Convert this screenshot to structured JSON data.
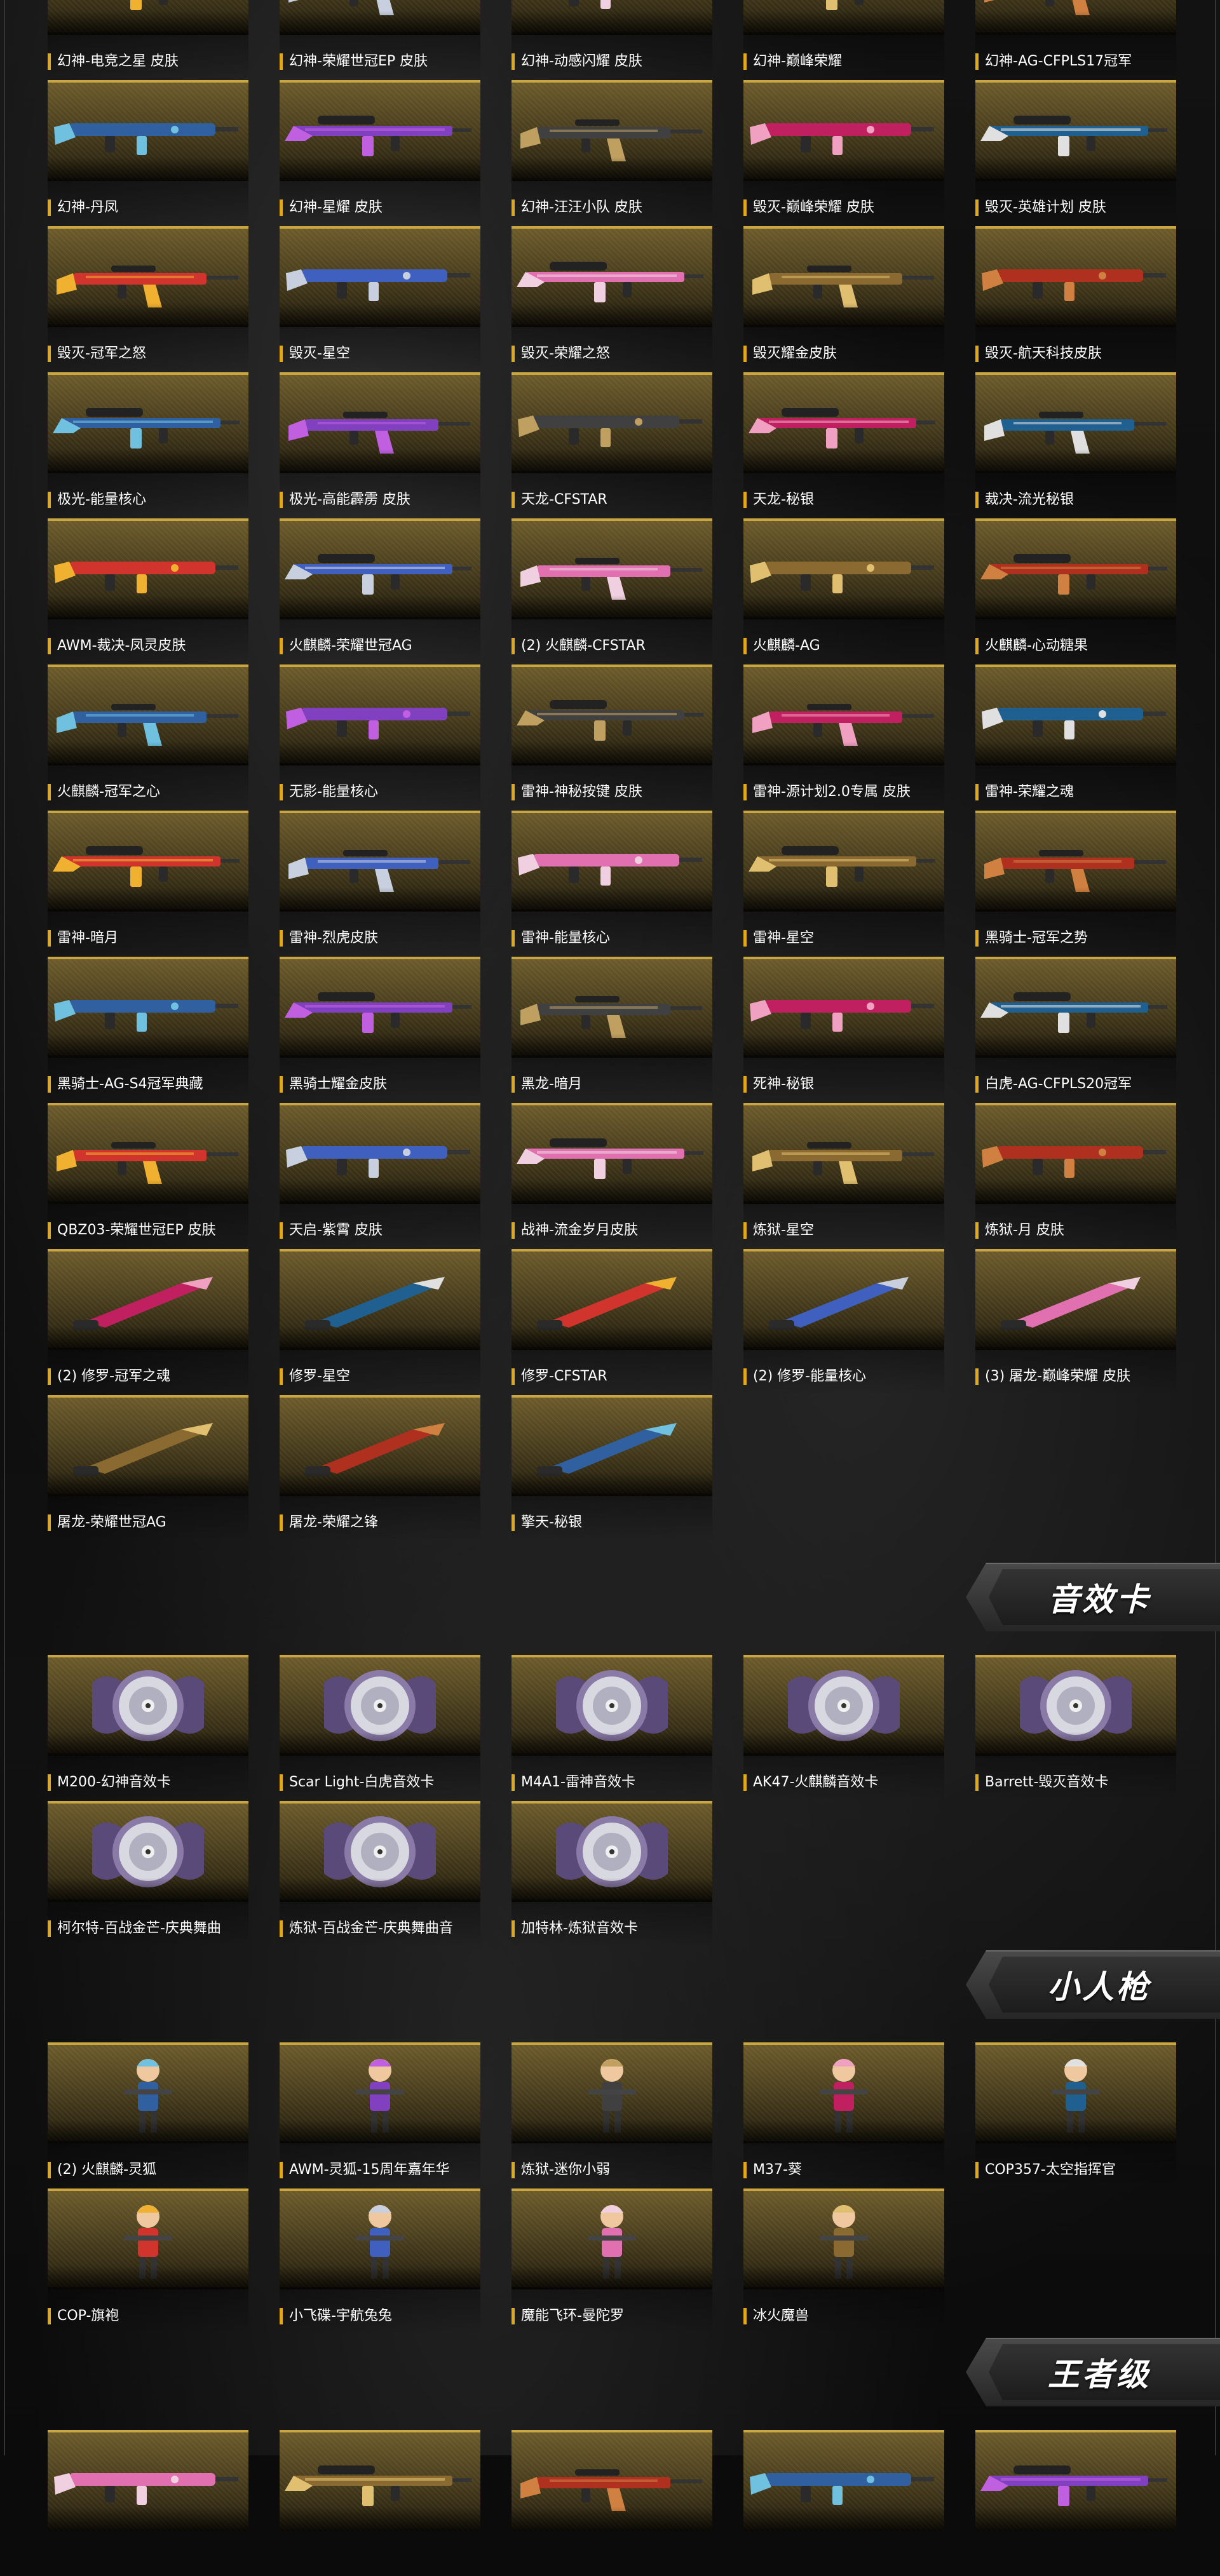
{
  "sections": {
    "weapons": {
      "items": [
        {
          "name": "幻神-电竞之星 皮肤"
        },
        {
          "name": "幻神-荣耀世冠EP 皮肤"
        },
        {
          "name": "幻神-动感闪耀 皮肤"
        },
        {
          "name": "幻神-巅峰荣耀"
        },
        {
          "name": "幻神-AG-CFPLS17冠军"
        },
        {
          "name": "幻神-丹凤"
        },
        {
          "name": "幻神-星耀 皮肤"
        },
        {
          "name": "幻神-汪汪小队 皮肤"
        },
        {
          "name": "毁灭-巅峰荣耀 皮肤"
        },
        {
          "name": "毁灭-英雄计划 皮肤"
        },
        {
          "name": "毁灭-冠军之怒"
        },
        {
          "name": "毁灭-星空"
        },
        {
          "name": "毁灭-荣耀之怒"
        },
        {
          "name": "毁灭耀金皮肤"
        },
        {
          "name": "毁灭-航天科技皮肤"
        },
        {
          "name": "极光-能量核心"
        },
        {
          "name": "极光-高能霹雳 皮肤"
        },
        {
          "name": "天龙-CFSTAR"
        },
        {
          "name": "天龙-秘银"
        },
        {
          "name": "裁决-流光秘银"
        },
        {
          "name": "AWM-裁决-凤灵皮肤"
        },
        {
          "name": "火麒麟-荣耀世冠AG"
        },
        {
          "name": "(2) 火麒麟-CFSTAR"
        },
        {
          "name": "火麒麟-AG"
        },
        {
          "name": "火麒麟-心动糖果"
        },
        {
          "name": "火麒麟-冠军之心"
        },
        {
          "name": "无影-能量核心"
        },
        {
          "name": "雷神-神秘按键 皮肤"
        },
        {
          "name": "雷神-源计划2.0专属 皮肤"
        },
        {
          "name": "雷神-荣耀之魂"
        },
        {
          "name": "雷神-暗月"
        },
        {
          "name": "雷神-烈虎皮肤"
        },
        {
          "name": "雷神-能量核心"
        },
        {
          "name": "雷神-星空"
        },
        {
          "name": "黑骑士-冠军之势"
        },
        {
          "name": "黑骑士-AG-S4冠军典藏"
        },
        {
          "name": "黑骑士耀金皮肤"
        },
        {
          "name": "黑龙-暗月"
        },
        {
          "name": "死神-秘银"
        },
        {
          "name": "白虎-AG-CFPLS20冠军"
        },
        {
          "name": "QBZ03-荣耀世冠EP 皮肤"
        },
        {
          "name": "天启-紫霄 皮肤"
        },
        {
          "name": "战神-流金岁月皮肤"
        },
        {
          "name": "炼狱-星空"
        },
        {
          "name": "炼狱-月 皮肤"
        },
        {
          "name": "(2) 修罗-冠军之魂"
        },
        {
          "name": "修罗-星空"
        },
        {
          "name": "修罗-CFSTAR"
        },
        {
          "name": "(2) 修罗-能量核心"
        },
        {
          "name": "(3) 屠龙-巅峰荣耀 皮肤"
        },
        {
          "name": "屠龙-荣耀世冠AG"
        },
        {
          "name": "屠龙-荣耀之锋"
        },
        {
          "name": "擎天-秘银"
        }
      ]
    },
    "sound": {
      "title": "音效卡",
      "items": [
        {
          "name": "M200-幻神音效卡"
        },
        {
          "name": "Scar Light-白虎音效卡"
        },
        {
          "name": "M4A1-雷神音效卡"
        },
        {
          "name": "AK47-火麒麟音效卡"
        },
        {
          "name": "Barrett-毁灭音效卡"
        },
        {
          "name": "柯尔特-百战金芒-庆典舞曲"
        },
        {
          "name": "炼狱-百战金芒-庆典舞曲音"
        },
        {
          "name": "加特林-炼狱音效卡"
        }
      ]
    },
    "figures": {
      "title": "小人枪",
      "items": [
        {
          "name": "(2) 火麒麟-灵狐"
        },
        {
          "name": "AWM-灵狐-15周年嘉年华"
        },
        {
          "name": "炼狱-迷你小弱"
        },
        {
          "name": "M37-葵"
        },
        {
          "name": "COP357-太空指挥官"
        },
        {
          "name": "COP-旗袍"
        },
        {
          "name": "小飞碟-宇航兔兔"
        },
        {
          "name": "魔能飞环-曼陀罗"
        },
        {
          "name": "冰火魔兽"
        }
      ]
    },
    "king": {
      "title": "王者级"
    }
  },
  "colors": {
    "accent": "#e1a81a",
    "card_top": "#c9a640"
  }
}
